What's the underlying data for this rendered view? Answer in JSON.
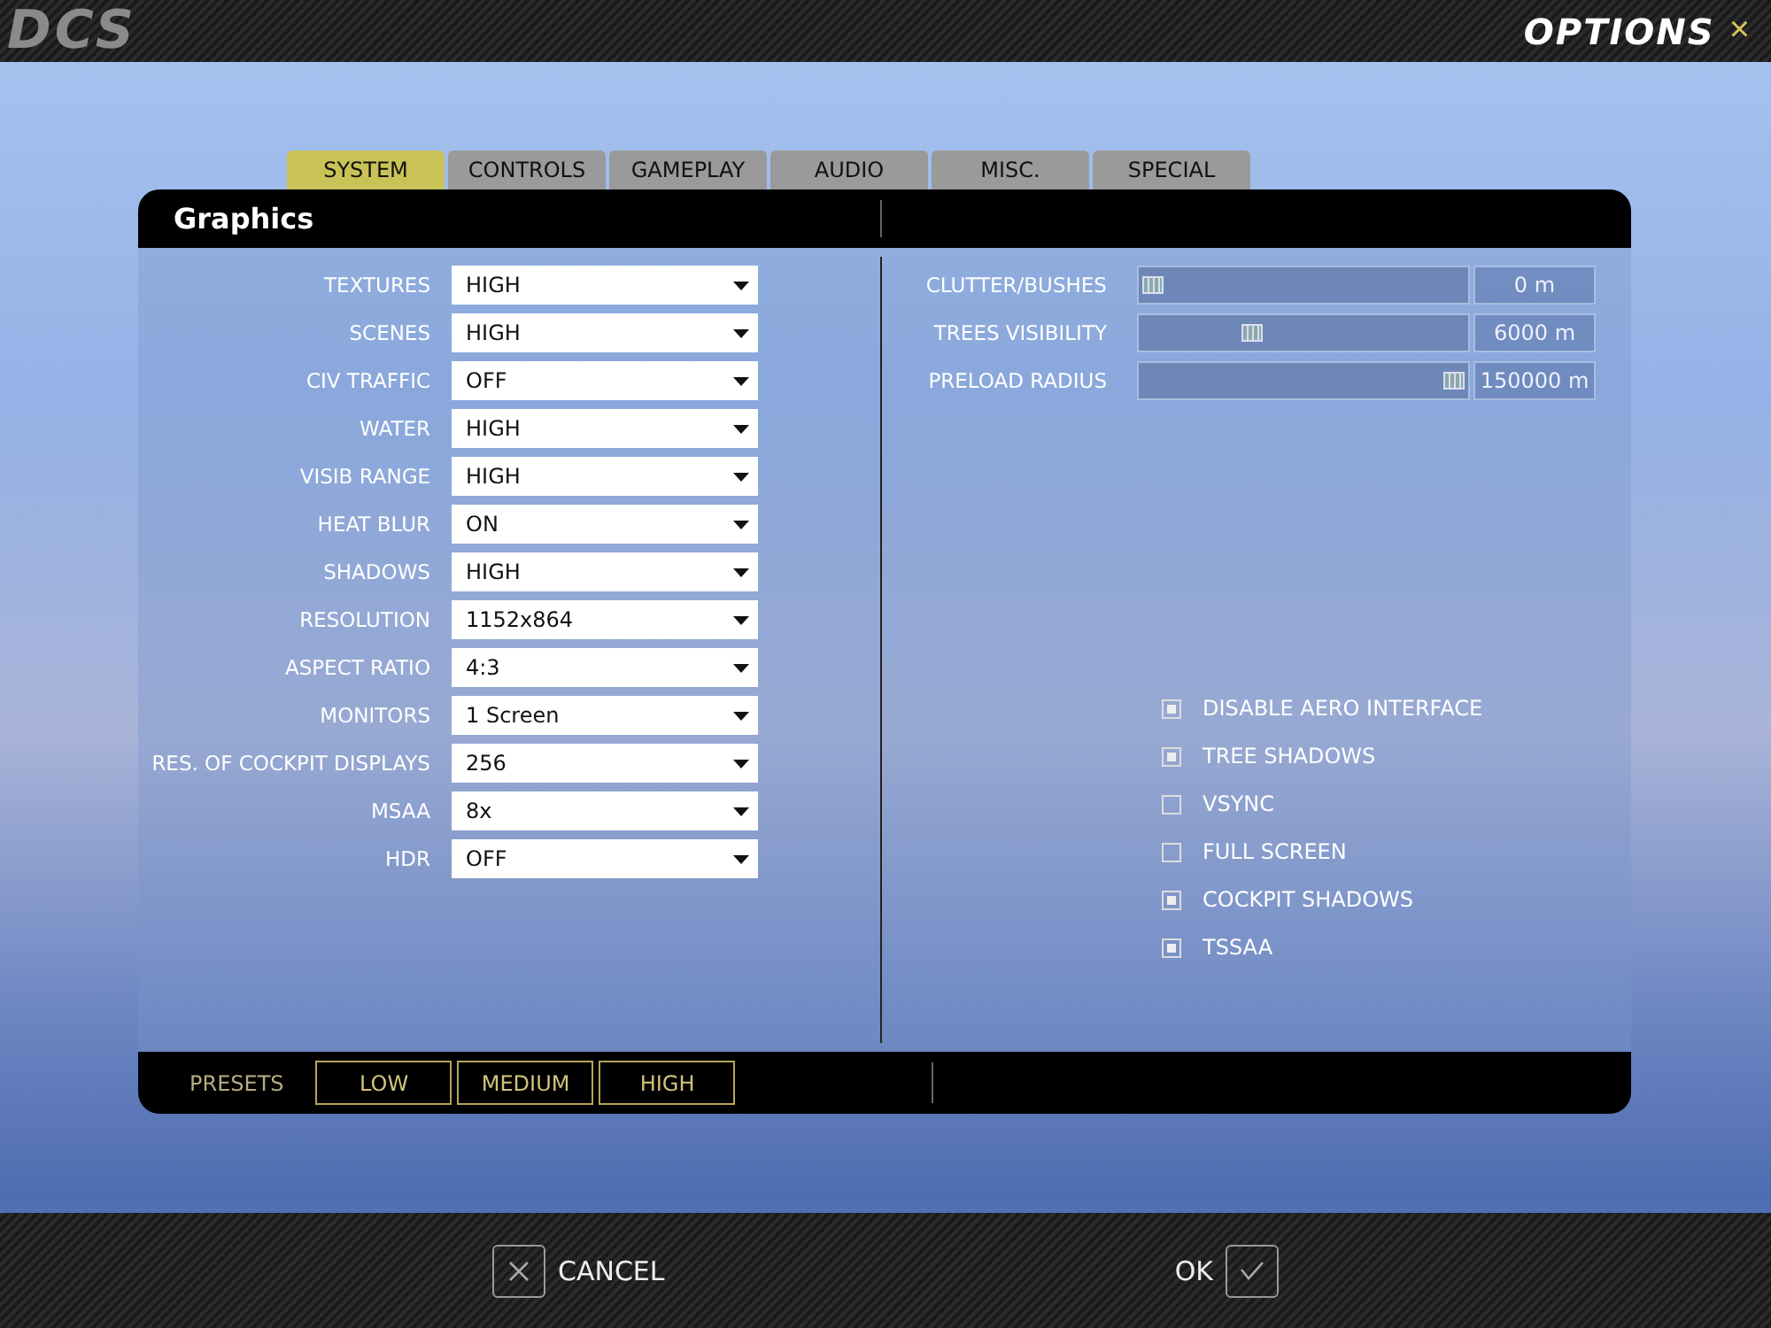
{
  "top_bar": {
    "logo": "DCS",
    "title": "OPTIONS",
    "close": "×"
  },
  "tabs": [
    {
      "label": "SYSTEM",
      "selected": true
    },
    {
      "label": "CONTROLS",
      "selected": false
    },
    {
      "label": "GAMEPLAY",
      "selected": false
    },
    {
      "label": "AUDIO",
      "selected": false
    },
    {
      "label": "MISC.",
      "selected": false
    },
    {
      "label": "SPECIAL",
      "selected": false
    }
  ],
  "panel": {
    "title": "Graphics",
    "dropdowns": [
      {
        "label": "TEXTURES",
        "value": "HIGH"
      },
      {
        "label": "SCENES",
        "value": "HIGH"
      },
      {
        "label": "CIV TRAFFIC",
        "value": "OFF"
      },
      {
        "label": "WATER",
        "value": "HIGH"
      },
      {
        "label": "VISIB RANGE",
        "value": "HIGH"
      },
      {
        "label": "HEAT BLUR",
        "value": "ON"
      },
      {
        "label": "SHADOWS",
        "value": "HIGH"
      },
      {
        "label": "RESOLUTION",
        "value": "1152x864"
      },
      {
        "label": "ASPECT RATIO",
        "value": "4:3"
      },
      {
        "label": "MONITORS",
        "value": "1 Screen"
      },
      {
        "label": "RES. OF COCKPIT DISPLAYS",
        "value": "256"
      },
      {
        "label": "MSAA",
        "value": "8x"
      },
      {
        "label": "HDR",
        "value": "OFF"
      }
    ],
    "sliders": [
      {
        "label": "CLUTTER/BUSHES",
        "level": 0,
        "reading": "0 m"
      },
      {
        "label": "TREES VISIBILITY",
        "level": 0.33,
        "reading": "6000 m"
      },
      {
        "label": "PRELOAD RADIUS",
        "level": 1,
        "reading": "150000 m"
      }
    ],
    "checkboxes": [
      {
        "label": "DISABLE AERO INTERFACE",
        "checked": true
      },
      {
        "label": "TREE SHADOWS",
        "checked": true
      },
      {
        "label": "VSYNC",
        "checked": false
      },
      {
        "label": "FULL SCREEN",
        "checked": false
      },
      {
        "label": "COCKPIT SHADOWS",
        "checked": true
      },
      {
        "label": "TSSAA",
        "checked": true
      }
    ],
    "presets_label": "PRESETS",
    "presets": [
      "LOW",
      "MEDIUM",
      "HIGH"
    ]
  },
  "bottom_bar": {
    "cancel": "CANCEL",
    "ok": "OK"
  }
}
